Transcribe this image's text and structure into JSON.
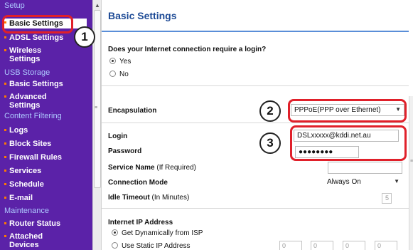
{
  "sidebar": {
    "sections": [
      {
        "heading": "Setup",
        "items": [
          "Basic Settings",
          "ADSL Settings",
          "Wireless Settings"
        ]
      },
      {
        "heading": "USB Storage",
        "items": [
          "Basic Settings",
          "Advanced Settings"
        ]
      },
      {
        "heading": "Content Filtering",
        "items": [
          "Logs",
          "Block Sites",
          "Firewall Rules",
          "Services",
          "Schedule",
          "E-mail"
        ]
      },
      {
        "heading": "Maintenance",
        "items": [
          "Router Status",
          "Attached Devices"
        ]
      }
    ]
  },
  "main": {
    "title": "Basic Settings",
    "login_question": "Does your Internet connection require a login?",
    "login_options": [
      "Yes",
      "No"
    ],
    "encapsulation": {
      "label": "Encapsulation",
      "value": "PPPoE(PPP over Ethernet)"
    },
    "login": {
      "label": "Login",
      "value": "DSLxxxxx@kddi.net.au"
    },
    "password": {
      "label": "Password",
      "value": "●●●●●●●●"
    },
    "service_name": {
      "label": "Service Name",
      "hint": "(If Required)",
      "value": ""
    },
    "connection_mode": {
      "label": "Connection Mode",
      "value": "Always On"
    },
    "idle_timeout": {
      "label": "Idle Timeout",
      "hint": "(In Minutes)",
      "value": "5"
    },
    "ip_section": {
      "heading": "Internet IP Address",
      "options": [
        "Get Dynamically from ISP",
        "Use Static IP Address"
      ],
      "ip_octets": [
        "0",
        "0",
        "0",
        "0"
      ]
    }
  },
  "annotations": {
    "callouts": [
      "1",
      "2",
      "3"
    ],
    "ring_color": "#e0202a"
  },
  "colors": {
    "sidebar_bg": "#5b22a8",
    "section_heading": "#aec9ff",
    "bullet": "#ff7a00",
    "title": "#1e4b96"
  }
}
